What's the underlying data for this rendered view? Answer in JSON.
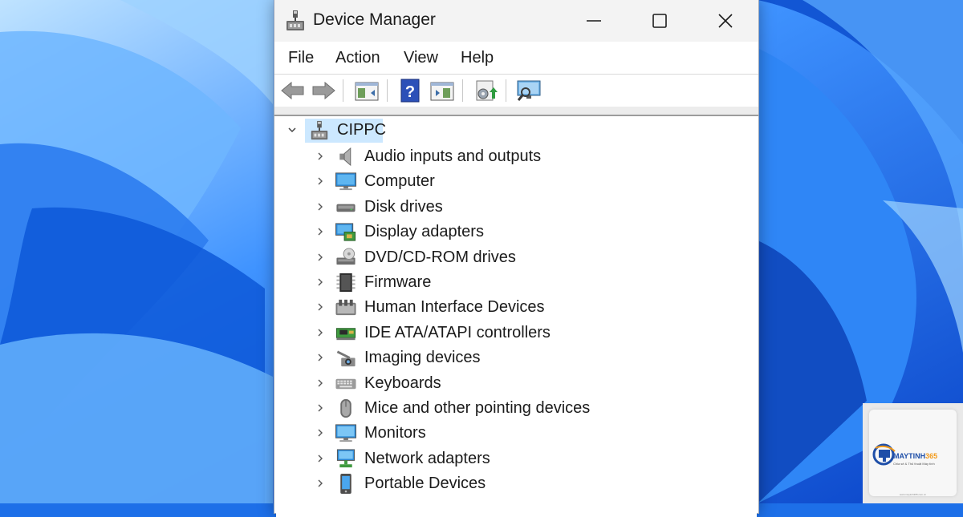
{
  "window": {
    "title": "Device Manager",
    "menu": [
      "File",
      "Action",
      "View",
      "Help"
    ]
  },
  "toolbar": {
    "buttons": [
      "back-icon",
      "forward-icon",
      "show-hide-console-tree-icon",
      "help-icon",
      "properties-icon",
      "update-driver-icon",
      "scan-hardware-icon"
    ]
  },
  "tree": {
    "root": "CIPPC",
    "root_expanded": true,
    "categories": [
      {
        "label": "Audio inputs and outputs",
        "icon": "speaker-icon"
      },
      {
        "label": "Computer",
        "icon": "computer-icon"
      },
      {
        "label": "Disk drives",
        "icon": "disk-drive-icon"
      },
      {
        "label": "Display adapters",
        "icon": "display-adapter-icon"
      },
      {
        "label": "DVD/CD-ROM drives",
        "icon": "dvd-drive-icon"
      },
      {
        "label": "Firmware",
        "icon": "firmware-chip-icon"
      },
      {
        "label": "Human Interface Devices",
        "icon": "hid-icon"
      },
      {
        "label": "IDE ATA/ATAPI controllers",
        "icon": "ide-controller-icon"
      },
      {
        "label": "Imaging devices",
        "icon": "camera-icon"
      },
      {
        "label": "Keyboards",
        "icon": "keyboard-icon"
      },
      {
        "label": "Mice and other pointing devices",
        "icon": "mouse-icon"
      },
      {
        "label": "Monitors",
        "icon": "monitor-icon"
      },
      {
        "label": "Network adapters",
        "icon": "network-adapter-icon"
      },
      {
        "label": "Portable Devices",
        "icon": "portable-device-icon"
      }
    ]
  },
  "watermark": {
    "brand_main": "MAYTINH",
    "brand_accent": "365",
    "tagline": "Chia sẻ & Thủ thuật Máy tính",
    "url": "www.maytinh365.com.vn"
  },
  "colors": {
    "accent": "#1d6fe8",
    "selection": "#cce8ff",
    "watermark_orange": "#f29a1a"
  }
}
